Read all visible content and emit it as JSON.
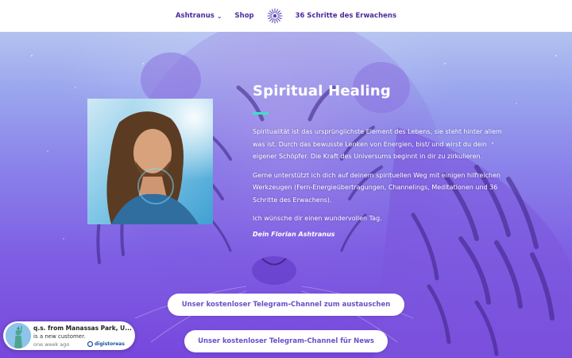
{
  "nav": {
    "items": [
      {
        "label": "Ashtranus",
        "has_dropdown": true,
        "chevron": "⌄"
      },
      {
        "label": "Shop"
      },
      {
        "label": "36 Schritte des Erwachens"
      }
    ],
    "logo_icon": "sun-mandala-icon",
    "color": "#4b2a9e"
  },
  "hero": {
    "title": "Spiritual Healing",
    "accent_color": "#3ee0c8",
    "paragraphs": [
      "Spiritualität ist das ursprünglichste Element des Lebens, sie steht hinter allem was ist. Durch das bewusste Lenken von Energien, bist/ und wirst du dein eigener Schöpfer. Die Kraft des Universums beginnt in dir zu zirkulieren.",
      "Gerne unterstützt ich dich auf deinem spirituellen Weg mit einigen hilfreichen Werkzeugen (Fern-Energieübertragungen, Channelings, Meditationen und 36 Schritte des Erwachens).",
      "Ich wünsche dir einen wundervollen Tag."
    ],
    "signature": "Dein Florian Ashtranus"
  },
  "cta": {
    "button1": "Unser kostenloser Telegram-Channel zum austauschen",
    "button2": "Unser kostenloser Telegram-Channel für News"
  },
  "notification": {
    "line1": "q.s. from Manassas Park, U...",
    "line2": "is a new customer.",
    "line3": "one week ago",
    "brand": "digistoreas",
    "avatar_icon": "statue-of-liberty-icon"
  }
}
